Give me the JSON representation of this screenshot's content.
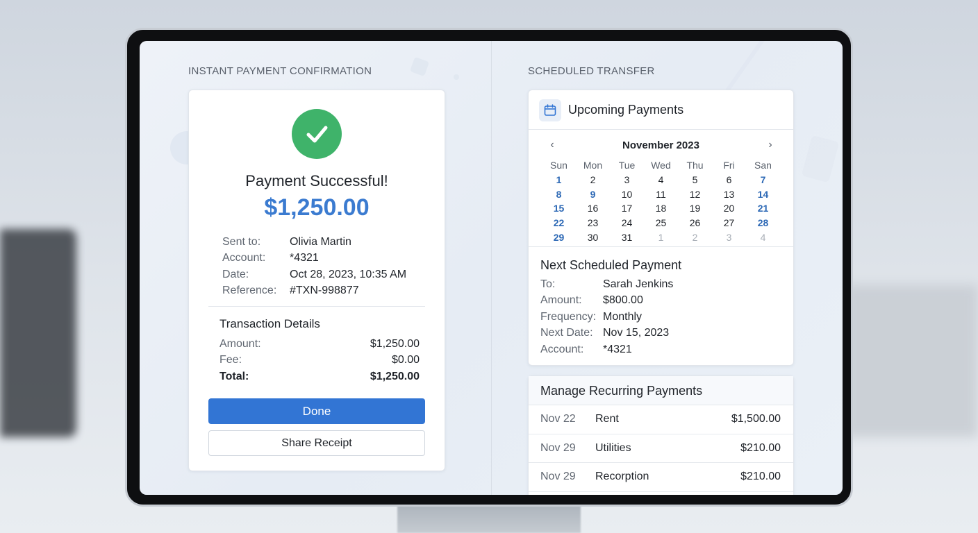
{
  "left": {
    "section_title": "INSTANT PAYMENT CONFIRMATION",
    "success_title": "Payment Successful!",
    "amount": "$1,250.00",
    "info": [
      {
        "label": "Sent to:",
        "value": "Olivia Martin"
      },
      {
        "label": "Account:",
        "value": "*4321"
      },
      {
        "label": "Date:",
        "value": "Oct 28, 2023, 10:35 AM"
      },
      {
        "label": "Reference:",
        "value": "#TXN-998877"
      }
    ],
    "details_title": "Transaction Details",
    "details": [
      {
        "label": "Amount:",
        "value": "$1,250.00"
      },
      {
        "label": "Fee:",
        "value": "$0.00"
      },
      {
        "label": "Total:",
        "value": "$1,250.00"
      }
    ],
    "done_label": "Done",
    "share_label": "Share Receipt"
  },
  "right": {
    "section_title": "SCHEDULED TRANSFER",
    "upcoming_title": "Upcoming Payments",
    "calendar": {
      "month": "November 2023",
      "prev_icon": "chevron-left-icon",
      "next_icon": "chevron-right-icon",
      "weekdays": [
        "Sun",
        "Mon",
        "Tue",
        "Wed",
        "Thu",
        "Fri",
        "San"
      ],
      "weeks": [
        [
          "1",
          "2",
          "3",
          "4",
          "5",
          "6",
          "7"
        ],
        [
          "8",
          "9",
          "10",
          "11",
          "12",
          "13",
          "14"
        ],
        [
          "15",
          "16",
          "17",
          "18",
          "19",
          "20",
          "21"
        ],
        [
          "22",
          "23",
          "24",
          "25",
          "26",
          "27",
          "28"
        ],
        [
          "29",
          "30",
          "31",
          "1",
          "2",
          "3",
          "4"
        ]
      ],
      "highlighted": [
        "1",
        "7",
        "8",
        "9",
        "14",
        "15",
        "21",
        "22",
        "28",
        "29"
      ]
    },
    "next_title": "Next Scheduled Payment",
    "next": [
      {
        "label": "To:",
        "value": "Sarah Jenkins"
      },
      {
        "label": "Amount:",
        "value": "$800.00"
      },
      {
        "label": "Frequency:",
        "value": "Monthly"
      },
      {
        "label": "Next Date:",
        "value": "Nov 15, 2023"
      },
      {
        "label": "Account:",
        "value": "*4321"
      }
    ],
    "manage_title": "Manage Recurring Payments",
    "recurring": [
      {
        "date": "Nov 22",
        "name": "Rent",
        "amount": "$1,500.00"
      },
      {
        "date": "Nov 29",
        "name": "Utilities",
        "amount": "$210.00"
      },
      {
        "date": "Nov 29",
        "name": "Recorption",
        "amount": "$210.00"
      }
    ]
  },
  "colors": {
    "accent": "#3275d4",
    "success": "#3fb36a",
    "amount": "#3b7bd0",
    "calendar_highlight": "#2c68b5"
  }
}
